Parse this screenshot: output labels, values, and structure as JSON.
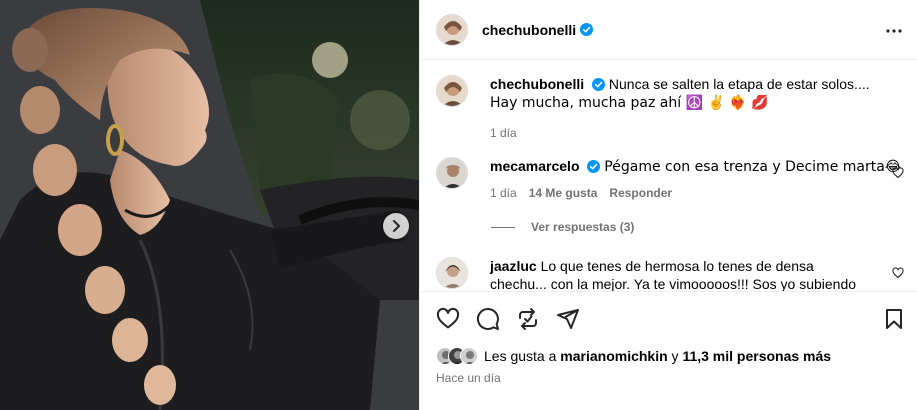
{
  "post": {
    "author": "chechubonelli",
    "caption_line1": "Nunca se salten la etapa de estar solos....",
    "caption_line2": "Hay mucha, mucha paz ahí ☮️ ✌️ ❤️‍🔥 💋",
    "caption_time": "1 día"
  },
  "comments": [
    {
      "username": "mecamarcelo",
      "text": "Pégame con esa trenza y Decime marta😂",
      "time": "1 día",
      "likes": "14 Me gusta",
      "reply": "Responder",
      "view_replies": "Ver respuestas (3)"
    },
    {
      "username": "jaazluc",
      "text_line1": "Lo que tenes de hermosa lo tenes de densa",
      "text_line2": "chechu... con la mejor. Ya te vimooooos!!! Sos yo subiendo"
    }
  ],
  "likes": {
    "prefix": "Les gusta a",
    "user": "marianomichkin",
    "connector": "y",
    "count": "11,3 mil personas más"
  },
  "post_date": "Hace un día",
  "icons": {
    "more": "more-horizontal-icon",
    "like": "heart-icon",
    "comment": "comment-icon",
    "repost": "repost-icon",
    "share": "share-icon",
    "save": "bookmark-icon",
    "next": "chevron-right-icon",
    "verified": "verified-badge-icon"
  },
  "colors": {
    "verified": "#0095f6",
    "muted": "#737373",
    "divider": "#efefef"
  }
}
